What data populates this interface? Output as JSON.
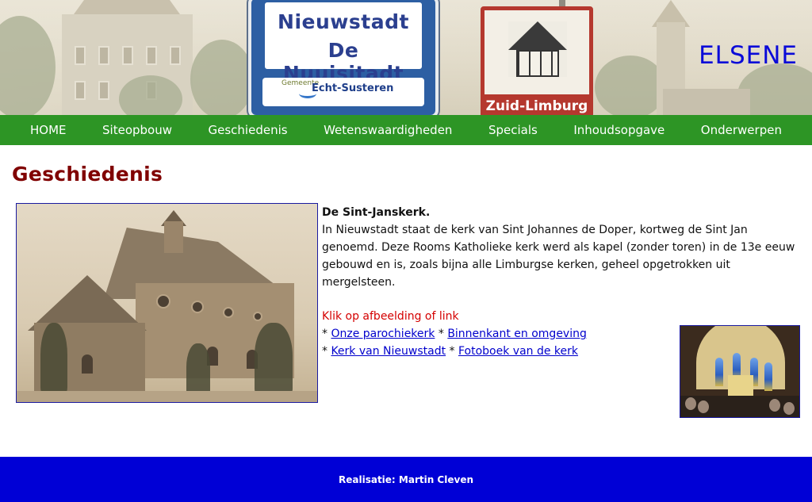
{
  "banner": {
    "site_title": "ELSENE",
    "sign_blue": {
      "line1": "Nieuwstadt",
      "line2": "De Nuujsjtadt",
      "gemeente_prefix": "Gemeente",
      "gemeente_name": "Echt-Susteren"
    },
    "sign_red": {
      "text": "Zuid-Limburg"
    }
  },
  "nav": {
    "items": [
      {
        "label": "HOME"
      },
      {
        "label": "Siteopbouw"
      },
      {
        "label": "Geschiedenis"
      },
      {
        "label": "Wetenswaardigheden"
      },
      {
        "label": "Specials"
      },
      {
        "label": "Inhoudsopgave"
      },
      {
        "label": "Onderwerpen"
      }
    ]
  },
  "main": {
    "page_title": "Geschiedenis",
    "article": {
      "heading": "De Sint-Janskerk.",
      "body": "In Nieuwstadt staat de kerk van Sint Johannes de Doper, kortweg de Sint Jan genoemd. Deze Rooms Katholieke kerk werd als kapel (zonder toren) in de 13e eeuw gebouwd en is, zoals bijna alle Limburgse kerken, geheel opgetrokken uit mergelsteen."
    },
    "click_hint": "Klik op afbeelding of link",
    "links": [
      {
        "label": "Onze parochiekerk"
      },
      {
        "label": "Binnenkant en omgeving"
      },
      {
        "label": "Kerk van Nieuwstadt"
      },
      {
        "label": "Fotoboek van de kerk"
      }
    ],
    "bullet": "*"
  },
  "footer": {
    "text": "Realisatie: Martin Cleven"
  },
  "colors": {
    "nav_bg": "#2d9525",
    "title": "#800000",
    "site_title": "#0a0ad8",
    "link": "#0000cc",
    "hint": "#d40000",
    "footer_bg": "#0000d6"
  }
}
